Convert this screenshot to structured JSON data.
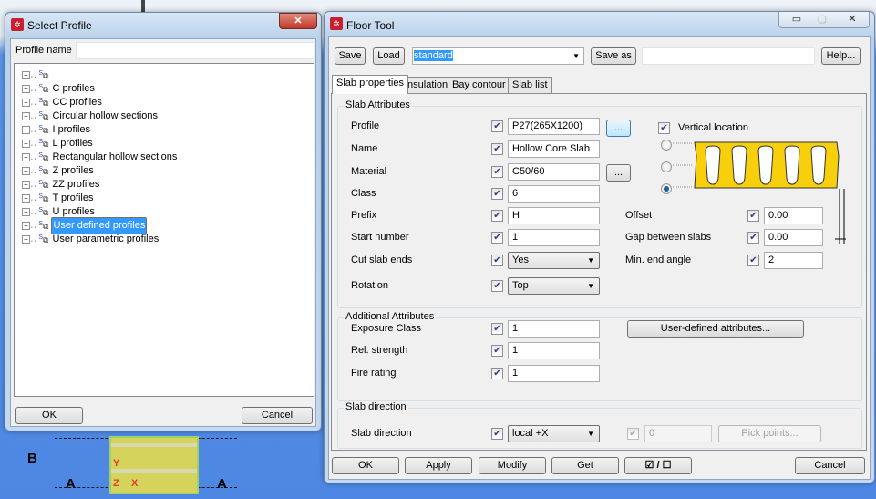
{
  "select_profile": {
    "title": "Select Profile",
    "profile_name_label": "Profile name",
    "profile_name_value": "",
    "tree": [
      "",
      "C profiles",
      "CC profiles",
      "Circular hollow sections",
      "I profiles",
      "L profiles",
      "Rectangular hollow sections",
      "Z profiles",
      "ZZ profiles",
      "T profiles",
      "U profiles",
      "User defined profiles",
      "User parametric profiles"
    ],
    "selected_index": 11,
    "ok": "OK",
    "cancel": "Cancel"
  },
  "floor_tool": {
    "title": "Floor Tool",
    "toolbar": {
      "save": "Save",
      "load": "Load",
      "preset": "standard",
      "save_as": "Save as",
      "save_as_value": "",
      "help": "Help..."
    },
    "tabs": [
      "Slab properties",
      "Insulation",
      "Bay contour",
      "Slab list"
    ],
    "slab_attributes": {
      "title": "Slab Attributes",
      "profile": {
        "label": "Profile",
        "value": "P27(265X1200)"
      },
      "name": {
        "label": "Name",
        "value": "Hollow Core Slab"
      },
      "material": {
        "label": "Material",
        "value": "C50/60"
      },
      "class": {
        "label": "Class",
        "value": "6"
      },
      "prefix": {
        "label": "Prefix",
        "value": "H"
      },
      "start_number": {
        "label": "Start number",
        "value": "1"
      },
      "cut_slab_ends": {
        "label": "Cut slab ends",
        "value": "Yes"
      },
      "rotation": {
        "label": "Rotation",
        "value": "Top"
      },
      "browse": "...",
      "vertical_location": "Vertical location",
      "offset": {
        "label": "Offset",
        "value": "0.00"
      },
      "gap": {
        "label": "Gap between slabs",
        "value": "0.00"
      },
      "min_end_angle": {
        "label": "Min. end angle",
        "value": "2"
      }
    },
    "additional": {
      "title": "Additional Attributes",
      "exposure": {
        "label": "Exposure Class",
        "value": "1"
      },
      "rel_strength": {
        "label": "Rel. strength",
        "value": "1"
      },
      "fire_rating": {
        "label": "Fire rating",
        "value": "1"
      },
      "uda_button": "User-defined attributes..."
    },
    "slab_direction": {
      "title": "Slab direction",
      "label": "Slab direction",
      "value": "local +X",
      "angle": "0",
      "pick_points": "Pick points..."
    },
    "buttons": {
      "ok": "OK",
      "apply": "Apply",
      "modify": "Modify",
      "get": "Get",
      "toggle": "☑ / ☐",
      "cancel": "Cancel"
    }
  },
  "cad": {
    "grid_a": "A",
    "grid_b": "B",
    "axis_y": "Y",
    "axis_z": "Z",
    "axis_x": "X"
  }
}
